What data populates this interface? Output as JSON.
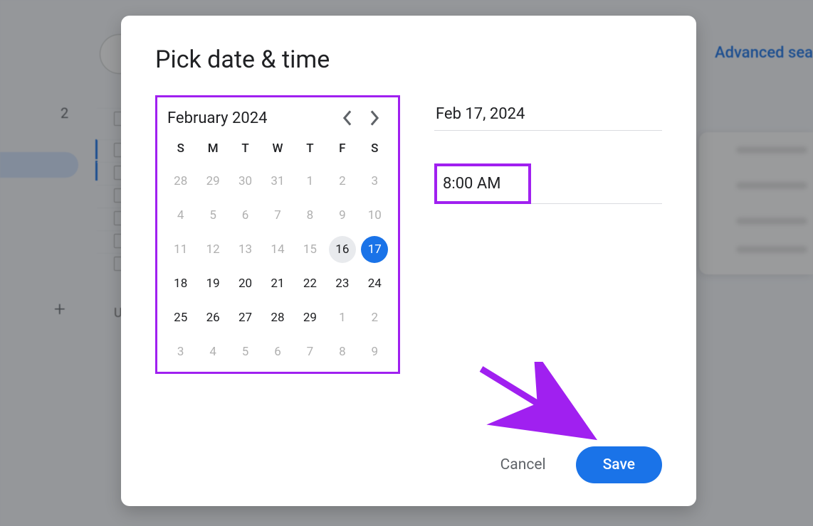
{
  "background": {
    "advanced_search": "Advanced sea",
    "num_label": "2",
    "u_label": "U"
  },
  "dialog": {
    "title": "Pick date & time",
    "calendar": {
      "month_label": "February 2024",
      "dow": [
        "S",
        "M",
        "T",
        "W",
        "T",
        "F",
        "S"
      ],
      "weeks": [
        [
          {
            "n": 28,
            "out": true
          },
          {
            "n": 29,
            "out": true
          },
          {
            "n": 30,
            "out": true
          },
          {
            "n": 31,
            "out": true
          },
          {
            "n": 1,
            "out": true
          },
          {
            "n": 2,
            "out": true
          },
          {
            "n": 3,
            "out": true
          }
        ],
        [
          {
            "n": 4,
            "out": true
          },
          {
            "n": 5,
            "out": true
          },
          {
            "n": 6,
            "out": true
          },
          {
            "n": 7,
            "out": true
          },
          {
            "n": 8,
            "out": true
          },
          {
            "n": 9,
            "out": true
          },
          {
            "n": 10,
            "out": true
          }
        ],
        [
          {
            "n": 11,
            "out": true
          },
          {
            "n": 12,
            "out": true
          },
          {
            "n": 13,
            "out": true
          },
          {
            "n": 14,
            "out": true
          },
          {
            "n": 15,
            "out": true
          },
          {
            "n": 16,
            "out": false,
            "today": true
          },
          {
            "n": 17,
            "out": false,
            "selected": true
          }
        ],
        [
          {
            "n": 18
          },
          {
            "n": 19
          },
          {
            "n": 20
          },
          {
            "n": 21
          },
          {
            "n": 22
          },
          {
            "n": 23
          },
          {
            "n": 24
          }
        ],
        [
          {
            "n": 25
          },
          {
            "n": 26
          },
          {
            "n": 27
          },
          {
            "n": 28
          },
          {
            "n": 29
          },
          {
            "n": 1,
            "out": true
          },
          {
            "n": 2,
            "out": true
          }
        ],
        [
          {
            "n": 3,
            "out": true
          },
          {
            "n": 4,
            "out": true
          },
          {
            "n": 5,
            "out": true
          },
          {
            "n": 6,
            "out": true
          },
          {
            "n": 7,
            "out": true
          },
          {
            "n": 8,
            "out": true
          },
          {
            "n": 9,
            "out": true
          }
        ]
      ]
    },
    "date_field": "Feb 17, 2024",
    "time_field": "8:00 AM",
    "cancel_label": "Cancel",
    "save_label": "Save"
  },
  "annotation": {
    "highlight_color": "#a020f0",
    "arrow_color": "#a020f0"
  }
}
